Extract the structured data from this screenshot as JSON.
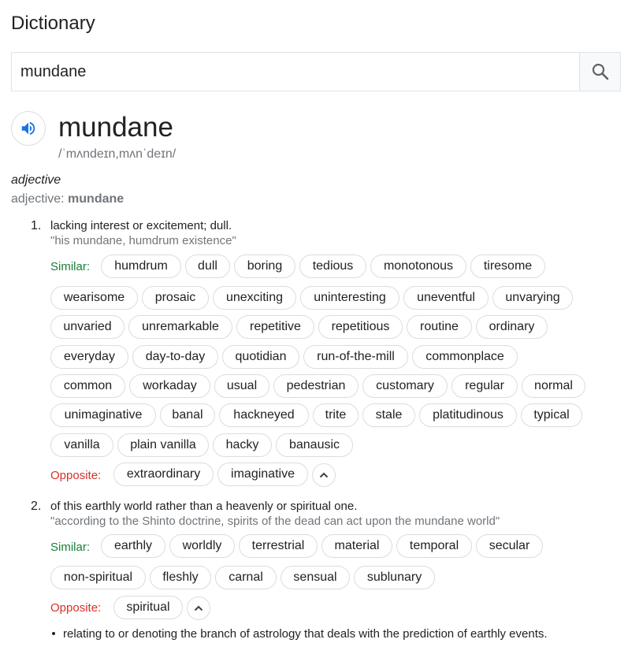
{
  "page_title": "Dictionary",
  "search": {
    "value": "mundane"
  },
  "entry": {
    "word": "mundane",
    "phonetic": "/ˈmʌndeɪn,mʌnˈdeɪn/",
    "part_of_speech": "adjective",
    "inflection_label": "adjective: ",
    "inflection_word": "mundane"
  },
  "similar_label": "Similar:",
  "opposite_label": "Opposite:",
  "senses": [
    {
      "number": "1.",
      "definition": "lacking interest or excitement; dull.",
      "example": "\"his mundane, humdrum existence\"",
      "similar": [
        "humdrum",
        "dull",
        "boring",
        "tedious",
        "monotonous",
        "tiresome",
        "wearisome",
        "prosaic",
        "unexciting",
        "uninteresting",
        "uneventful",
        "unvarying",
        "unvaried",
        "unremarkable",
        "repetitive",
        "repetitious",
        "routine",
        "ordinary",
        "everyday",
        "day-to-day",
        "quotidian",
        "run-of-the-mill",
        "commonplace",
        "common",
        "workaday",
        "usual",
        "pedestrian",
        "customary",
        "regular",
        "normal",
        "unimaginative",
        "banal",
        "hackneyed",
        "trite",
        "stale",
        "platitudinous",
        "typical",
        "vanilla",
        "plain vanilla",
        "hacky",
        "banausic"
      ],
      "opposite": [
        "extraordinary",
        "imaginative"
      ]
    },
    {
      "number": "2.",
      "definition": "of this earthly world rather than a heavenly or spiritual one.",
      "example": "\"according to the Shinto doctrine, spirits of the dead can act upon the mundane world\"",
      "similar": [
        "earthly",
        "worldly",
        "terrestrial",
        "material",
        "temporal",
        "secular",
        "non-spiritual",
        "fleshly",
        "carnal",
        "sensual",
        "sublunary"
      ],
      "opposite": [
        "spiritual"
      ]
    }
  ],
  "subsense": "relating to or denoting the branch of astrology that deals with the prediction of earthly events.",
  "colors": {
    "similar": "#188038",
    "opposite": "#d93025",
    "speaker": "#1a73e8"
  },
  "icons": {
    "search": "search-icon",
    "speaker": "speaker-icon",
    "collapse": "chevron-up-icon"
  }
}
